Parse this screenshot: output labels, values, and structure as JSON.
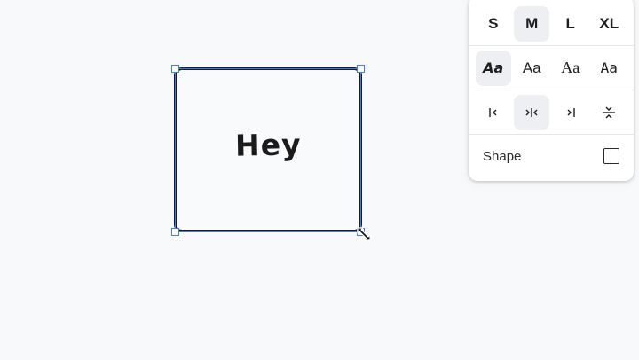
{
  "canvas": {
    "shape_text": "Hey"
  },
  "panel": {
    "sizes": [
      {
        "label": "S",
        "selected": false
      },
      {
        "label": "M",
        "selected": true
      },
      {
        "label": "L",
        "selected": false
      },
      {
        "label": "XL",
        "selected": false
      }
    ],
    "fonts": [
      {
        "label": "Aa",
        "style": "draw",
        "selected": true
      },
      {
        "label": "Aa",
        "style": "sans",
        "selected": false
      },
      {
        "label": "Aa",
        "style": "serif",
        "selected": false
      },
      {
        "label": "Aa",
        "style": "mono",
        "selected": false
      }
    ],
    "align": [
      {
        "glyph": "|‹",
        "name": "align-start-icon",
        "selected": false
      },
      {
        "glyph": "›|‹",
        "name": "align-middle-icon",
        "selected": true
      },
      {
        "glyph": "›|",
        "name": "align-end-icon",
        "selected": false
      },
      {
        "glyph": "⌄⌃",
        "name": "vertical-align-icon",
        "selected": false
      }
    ],
    "shape_label": "Shape"
  },
  "colors": {
    "accent": "#3d7df3",
    "ink": "#1b1b1b",
    "selected_bg": "#eeeff2"
  }
}
